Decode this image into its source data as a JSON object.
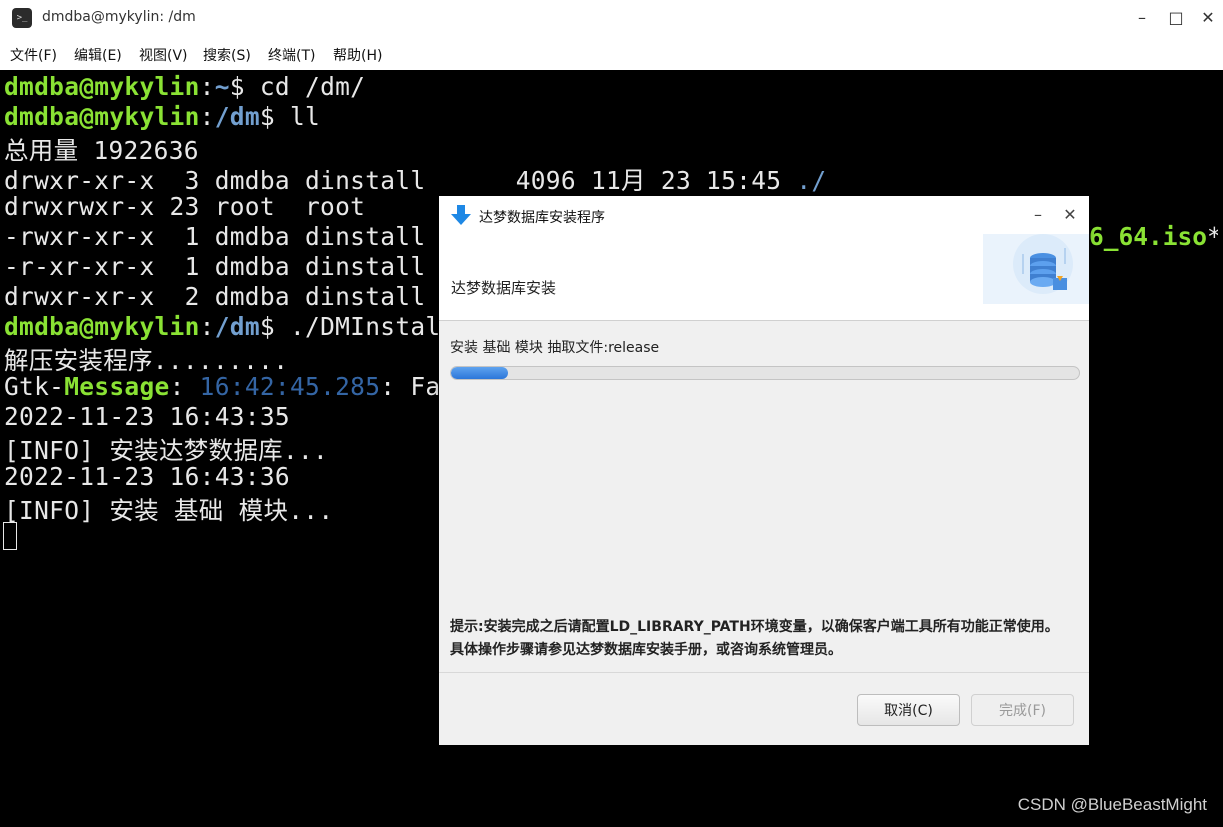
{
  "window": {
    "title": "dmdba@mykylin: /dm",
    "icon": "terminal-icon",
    "minimize": "–",
    "maximize": "□",
    "close": "✕"
  },
  "menu": [
    "文件(F)",
    "编辑(E)",
    "视图(V)",
    "搜索(S)",
    "终端(T)",
    "帮助(H)"
  ],
  "terminal": {
    "prompt_user": "dmdba@mykylin",
    "lines": {
      "l1_path": "~",
      "l1_cmd": "$ cd /dm/",
      "l2_path": "/dm",
      "l2_cmd": "$ ll",
      "l3": "总用量 1922636",
      "l4_text": "drwxr-xr-x  3 dmdba dinstall      4096 11月 23 15:45 ",
      "l4_dir": "./",
      "l5": "drwxrwxr-x 23 root  root",
      "l6": "-rwxr-xr-x  1 dmdba dinstall",
      "l6_right_file": "6_64.iso",
      "l6_right_mark": "*",
      "l7": "-r-xr-xr-x  1 dmdba dinstall",
      "l8": "drwxr-xr-x  2 dmdba dinstall",
      "l9_path": "/dm",
      "l9_cmd": "$ ./DMInstal",
      "l10": "解压安装程序.........",
      "l11_a": "Gtk-",
      "l11_b": "Message",
      "l11_c": ": ",
      "l11_time": "16:42:45.285",
      "l11_d": ": Fa",
      "l12": "2022-11-23 16:43:35",
      "l13": "[INFO] 安装达梦数据库...",
      "l14": "2022-11-23 16:43:36",
      "l15": "[INFO] 安装 基础 模块..."
    }
  },
  "dialog": {
    "title": "达梦数据库安装程序",
    "header_title": "达梦数据库安装",
    "status": "安装 基础 模块 抽取文件:release",
    "progress": 0.09,
    "hint": "提示:安装完成之后请配置LD_LIBRARY_PATH环境变量，以确保客户端工具所有功能正常使用。具体操作步骤请参见达梦数据库安装手册，或咨询系统管理员。",
    "cancel_label": "取消(C)",
    "finish_label": "完成(F)",
    "minimize": "–",
    "close": "✕"
  },
  "watermark": "CSDN @BlueBeastMight"
}
